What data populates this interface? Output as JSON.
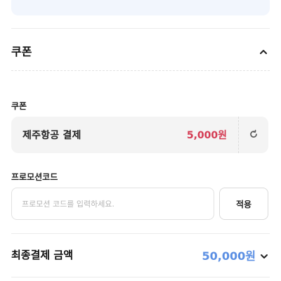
{
  "coupon_section": {
    "title": "쿠폰",
    "coupon_label": "쿠폰",
    "coupon_name": "제주항공  결제",
    "coupon_amount": "5,000원"
  },
  "promo": {
    "label": "프로모션코드",
    "placeholder": "프로모션 코드를 입력하세요.",
    "apply_label": "적용"
  },
  "total": {
    "label": "최종결제 금액",
    "amount": "50,000원"
  },
  "icons": {
    "collapse": "chevron-up-icon",
    "reset": "refresh-icon",
    "expand": "chevron-down-icon"
  },
  "colors": {
    "coupon_amount": "#d43a52",
    "total_amount": "#5b8fe3",
    "top_box": "#f2f6fd"
  }
}
